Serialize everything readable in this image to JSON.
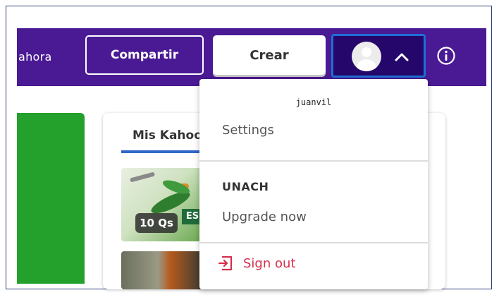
{
  "topbar": {
    "partial_nav_text": "ahora",
    "share_label": "Compartir",
    "create_label": "Crear"
  },
  "content": {
    "tab_label": "Mis Kahoots",
    "card1": {
      "badge": "10 Qs",
      "sign_text": "ES"
    }
  },
  "dropdown": {
    "username": "juanvil",
    "settings_label": "Settings",
    "org_name": "UNACH",
    "upgrade_label": "Upgrade now",
    "signout_label": "Sign out"
  },
  "colors": {
    "topbar": "#4a1a94",
    "profile_button": "#25076b",
    "focus_ring": "#1f6ed4",
    "green_panel": "#24a02c",
    "tab_underline": "#3066c8",
    "signout": "#d62f4d"
  },
  "icons": {
    "avatar": "user-avatar-icon",
    "chevron": "chevron-up-icon",
    "info": "info-icon",
    "signout": "sign-out-icon"
  }
}
